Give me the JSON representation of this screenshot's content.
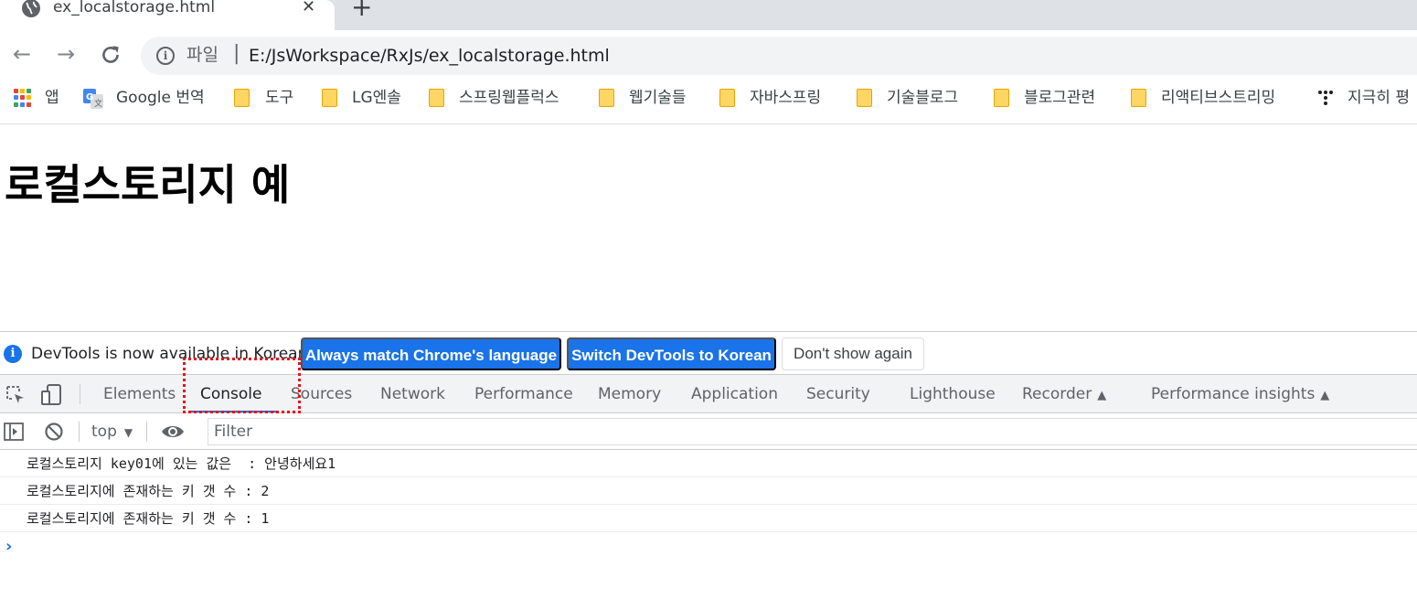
{
  "browser": {
    "tab": {
      "title": "ex_localstorage.html"
    },
    "omnibox": {
      "file_label": "파일",
      "url": "E:/JsWorkspace/RxJs/ex_localstorage.html"
    },
    "bookmarks": [
      {
        "label": "앱"
      },
      {
        "label": "Google 번역"
      },
      {
        "label": "도구"
      },
      {
        "label": "LG엔솔"
      },
      {
        "label": "스프링웹플럭스"
      },
      {
        "label": "웹기술들"
      },
      {
        "label": "자바스프링"
      },
      {
        "label": "기술블로그"
      },
      {
        "label": "블로그관련"
      },
      {
        "label": "리액티브스트리밍"
      },
      {
        "label": "지극히 평"
      }
    ]
  },
  "page": {
    "heading": "로컬스토리지 예"
  },
  "devtools": {
    "infobar": {
      "message": "DevTools is now available in Korean!",
      "match_button": "Always match Chrome's language",
      "switch_button": "Switch DevTools to Korean",
      "dismiss_button": "Don't show again"
    },
    "tabs": [
      "Elements",
      "Console",
      "Sources",
      "Network",
      "Performance",
      "Memory",
      "Application",
      "Security",
      "Lighthouse",
      "Recorder",
      "Performance insights"
    ],
    "active_tab": "Console",
    "console_toolbar": {
      "context": "top",
      "filter_placeholder": "Filter"
    },
    "console_lines": [
      "로컬스토리지 key01에 있는 값은  : 안녕하세요1",
      "로컬스토리지에 존재하는 키 갯 수 : 2",
      "로컬스토리지에 존재하는 키 갯 수 : 1"
    ],
    "accent_color": "#1a73e8",
    "highlight_color": "#e8111b"
  }
}
